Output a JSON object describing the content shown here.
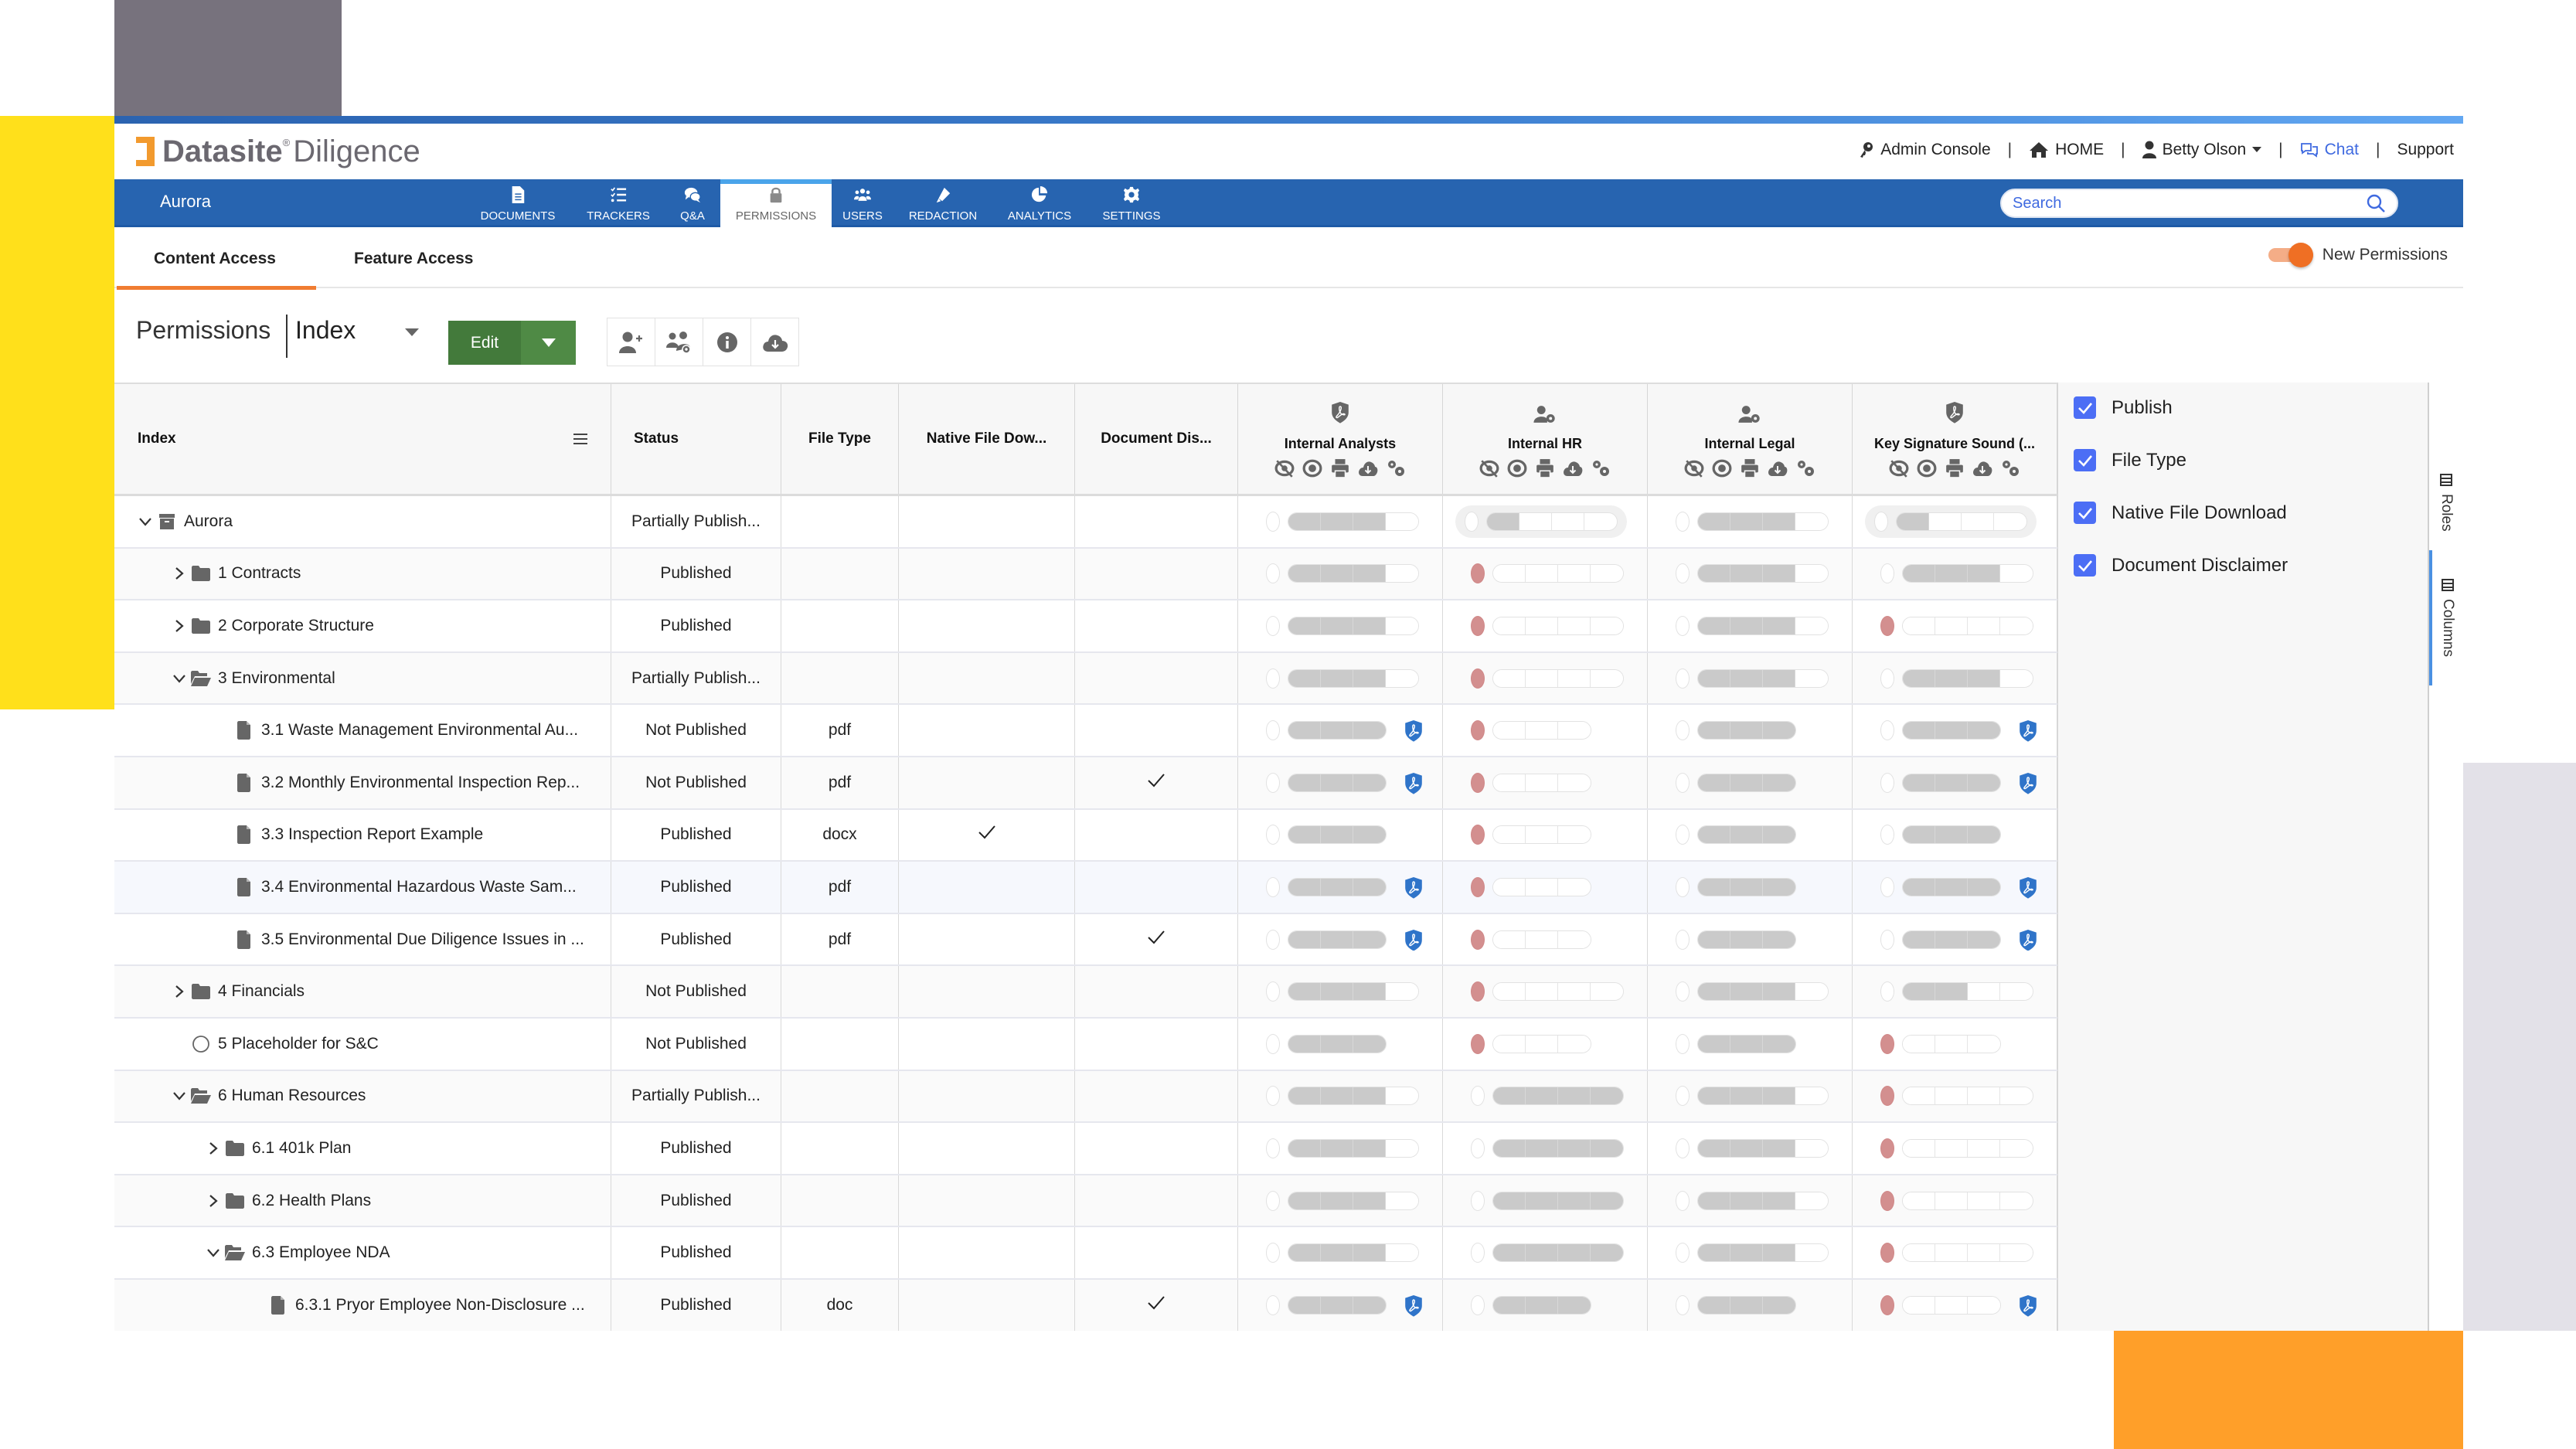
{
  "header": {
    "brand": "Datasite",
    "product": "Diligence",
    "utility_links": [
      {
        "label": "Admin Console",
        "icon": "key-icon"
      },
      {
        "label": "HOME",
        "icon": "home-icon"
      },
      {
        "label": "Betty Olson",
        "icon": "user-icon"
      },
      {
        "label": "Chat",
        "icon": "chat-icon"
      },
      {
        "label": "Support",
        "icon": ""
      }
    ]
  },
  "nav": {
    "project": "Aurora",
    "tabs": [
      {
        "label": "DOCUMENTS",
        "icon": "document-icon",
        "active": false
      },
      {
        "label": "TRACKERS",
        "icon": "tracker-list-icon",
        "active": false
      },
      {
        "label": "Q&A",
        "icon": "chat-bubbles-icon",
        "active": false
      },
      {
        "label": "PERMISSIONS",
        "icon": "lock-icon",
        "active": true
      },
      {
        "label": "USERS",
        "icon": "users-icon",
        "active": false
      },
      {
        "label": "REDACTION",
        "icon": "highlighter-icon",
        "active": false
      },
      {
        "label": "ANALYTICS",
        "icon": "pie-chart-icon",
        "active": false
      },
      {
        "label": "SETTINGS",
        "icon": "gear-icon",
        "active": false
      }
    ],
    "search_placeholder": "Search"
  },
  "subtabs": {
    "items": [
      "Content Access",
      "Feature Access"
    ],
    "active": "Content Access",
    "toggle_label": "New Permissions",
    "toggle_on": true
  },
  "toolbar": {
    "title": "Permissions",
    "view_select": "Index",
    "edit_label": "Edit",
    "icon_buttons": [
      "add-user-icon",
      "manage-groups-icon",
      "info-icon",
      "cloud-download-icon"
    ]
  },
  "grid": {
    "columns": {
      "index": "Index",
      "status": "Status",
      "file_type": "File Type",
      "native": "Native File Dow...",
      "disclaimer": "Document Dis..."
    },
    "roles": [
      {
        "name": "Internal Analysts",
        "icon": "shield-pdf-icon"
      },
      {
        "name": "Internal HR",
        "icon": "user-gear-icon"
      },
      {
        "name": "Internal Legal",
        "icon": "user-gear-icon"
      },
      {
        "name": "Key Signature Sound (...",
        "icon": "shield-pdf-icon"
      }
    ],
    "permission_icons": [
      "hidden-icon",
      "view-icon",
      "print-icon",
      "download-icon",
      "settings-icon"
    ],
    "rows": [
      {
        "name": "Aurora",
        "type": "root",
        "level": 0,
        "expanded": true,
        "status": "Partially Publish...",
        "file_type": "",
        "native": false,
        "disclaimer": false,
        "perms": [
          {
            "red": false,
            "level": 3,
            "segs": 4,
            "pdf": false
          },
          {
            "red": false,
            "level": 1,
            "segs": 4,
            "pdf": false,
            "selected": true
          },
          {
            "red": false,
            "level": 3,
            "segs": 4,
            "pdf": false
          },
          {
            "red": false,
            "level": 1,
            "segs": 4,
            "pdf": false,
            "selected": true
          }
        ]
      },
      {
        "name": "1 Contracts",
        "type": "folder",
        "level": 1,
        "expanded": false,
        "status": "Published",
        "file_type": "",
        "native": false,
        "disclaimer": false,
        "perms": [
          {
            "red": false,
            "level": 3,
            "segs": 4
          },
          {
            "red": true,
            "level": 0,
            "segs": 4
          },
          {
            "red": false,
            "level": 3,
            "segs": 4
          },
          {
            "red": false,
            "level": 3,
            "segs": 4
          }
        ]
      },
      {
        "name": "2 Corporate Structure",
        "type": "folder",
        "level": 1,
        "expanded": false,
        "status": "Published",
        "file_type": "",
        "native": false,
        "disclaimer": false,
        "perms": [
          {
            "red": false,
            "level": 3,
            "segs": 4
          },
          {
            "red": true,
            "level": 0,
            "segs": 4
          },
          {
            "red": false,
            "level": 3,
            "segs": 4
          },
          {
            "red": true,
            "level": 0,
            "segs": 4
          }
        ]
      },
      {
        "name": "3 Environmental",
        "type": "folder-open",
        "level": 1,
        "expanded": true,
        "status": "Partially Publish...",
        "file_type": "",
        "native": false,
        "disclaimer": false,
        "perms": [
          {
            "red": false,
            "level": 3,
            "segs": 4
          },
          {
            "red": true,
            "level": 0,
            "segs": 4
          },
          {
            "red": false,
            "level": 3,
            "segs": 4
          },
          {
            "red": false,
            "level": 3,
            "segs": 4
          }
        ]
      },
      {
        "name": "3.1 Waste Management Environmental Au...",
        "type": "file",
        "level": 2,
        "status": "Not Published",
        "file_type": "pdf",
        "native": false,
        "disclaimer": false,
        "perms": [
          {
            "red": false,
            "level": 3,
            "segs": 3,
            "pdf": true
          },
          {
            "red": true,
            "level": 0,
            "segs": 3
          },
          {
            "red": false,
            "level": 3,
            "segs": 3
          },
          {
            "red": false,
            "level": 3,
            "segs": 3,
            "pdf": true
          }
        ]
      },
      {
        "name": "3.2 Monthly Environmental Inspection Rep...",
        "type": "file",
        "level": 2,
        "status": "Not Published",
        "file_type": "pdf",
        "native": false,
        "disclaimer": true,
        "perms": [
          {
            "red": false,
            "level": 3,
            "segs": 3,
            "pdf": true
          },
          {
            "red": true,
            "level": 0,
            "segs": 3
          },
          {
            "red": false,
            "level": 3,
            "segs": 3
          },
          {
            "red": false,
            "level": 3,
            "segs": 3,
            "pdf": true
          }
        ]
      },
      {
        "name": "3.3 Inspection Report Example",
        "type": "file",
        "level": 2,
        "status": "Published",
        "file_type": "docx",
        "native": true,
        "disclaimer": false,
        "perms": [
          {
            "red": false,
            "level": 3,
            "segs": 3
          },
          {
            "red": true,
            "level": 0,
            "segs": 3
          },
          {
            "red": false,
            "level": 3,
            "segs": 3
          },
          {
            "red": false,
            "level": 3,
            "segs": 3
          }
        ]
      },
      {
        "name": "3.4 Environmental Hazardous Waste Sam...",
        "type": "file",
        "level": 2,
        "status": "Published",
        "file_type": "pdf",
        "native": false,
        "disclaimer": false,
        "hover": true,
        "perms": [
          {
            "red": false,
            "level": 3,
            "segs": 3,
            "pdf": true
          },
          {
            "red": true,
            "level": 0,
            "segs": 3
          },
          {
            "red": false,
            "level": 3,
            "segs": 3
          },
          {
            "red": false,
            "level": 3,
            "segs": 3,
            "pdf": true
          }
        ]
      },
      {
        "name": "3.5 Environmental Due Diligence Issues in ...",
        "type": "file",
        "level": 2,
        "status": "Published",
        "file_type": "pdf",
        "native": false,
        "disclaimer": true,
        "perms": [
          {
            "red": false,
            "level": 3,
            "segs": 3,
            "pdf": true
          },
          {
            "red": true,
            "level": 0,
            "segs": 3
          },
          {
            "red": false,
            "level": 3,
            "segs": 3
          },
          {
            "red": false,
            "level": 3,
            "segs": 3,
            "pdf": true
          }
        ]
      },
      {
        "name": "4 Financials",
        "type": "folder",
        "level": 1,
        "expanded": false,
        "status": "Not Published",
        "file_type": "",
        "native": false,
        "disclaimer": false,
        "perms": [
          {
            "red": false,
            "level": 3,
            "segs": 4
          },
          {
            "red": true,
            "level": 0,
            "segs": 4
          },
          {
            "red": false,
            "level": 3,
            "segs": 4
          },
          {
            "red": false,
            "level": 2,
            "segs": 4
          }
        ]
      },
      {
        "name": "5 Placeholder for S&C",
        "type": "placeholder",
        "level": 1,
        "status": "Not Published",
        "file_type": "",
        "native": false,
        "disclaimer": false,
        "perms": [
          {
            "red": false,
            "level": 3,
            "segs": 3
          },
          {
            "red": true,
            "level": 0,
            "segs": 3
          },
          {
            "red": false,
            "level": 3,
            "segs": 3
          },
          {
            "red": true,
            "level": 0,
            "segs": 3
          }
        ]
      },
      {
        "name": "6 Human Resources",
        "type": "folder-open",
        "level": 1,
        "expanded": true,
        "status": "Partially Publish...",
        "file_type": "",
        "native": false,
        "disclaimer": false,
        "perms": [
          {
            "red": false,
            "level": 3,
            "segs": 4
          },
          {
            "red": false,
            "level": 4,
            "segs": 4
          },
          {
            "red": false,
            "level": 3,
            "segs": 4
          },
          {
            "red": true,
            "level": 0,
            "segs": 4
          }
        ]
      },
      {
        "name": "6.1 401k Plan",
        "type": "folder",
        "level": 2,
        "expanded": false,
        "status": "Published",
        "file_type": "",
        "native": false,
        "disclaimer": false,
        "perms": [
          {
            "red": false,
            "level": 3,
            "segs": 4
          },
          {
            "red": false,
            "level": 4,
            "segs": 4
          },
          {
            "red": false,
            "level": 3,
            "segs": 4
          },
          {
            "red": true,
            "level": 0,
            "segs": 4
          }
        ]
      },
      {
        "name": "6.2 Health Plans",
        "type": "folder",
        "level": 2,
        "expanded": false,
        "status": "Published",
        "file_type": "",
        "native": false,
        "disclaimer": false,
        "perms": [
          {
            "red": false,
            "level": 3,
            "segs": 4
          },
          {
            "red": false,
            "level": 4,
            "segs": 4
          },
          {
            "red": false,
            "level": 3,
            "segs": 4
          },
          {
            "red": true,
            "level": 0,
            "segs": 4
          }
        ]
      },
      {
        "name": "6.3 Employee NDA",
        "type": "folder-open",
        "level": 2,
        "expanded": true,
        "status": "Published",
        "file_type": "",
        "native": false,
        "disclaimer": false,
        "perms": [
          {
            "red": false,
            "level": 3,
            "segs": 4
          },
          {
            "red": false,
            "level": 4,
            "segs": 4
          },
          {
            "red": false,
            "level": 3,
            "segs": 4
          },
          {
            "red": true,
            "level": 0,
            "segs": 4
          }
        ]
      },
      {
        "name": "6.3.1 Pryor Employee Non-Disclosure ...",
        "type": "file",
        "level": 3,
        "status": "Published",
        "file_type": "doc",
        "native": false,
        "disclaimer": true,
        "perms": [
          {
            "red": false,
            "level": 3,
            "segs": 3,
            "pdf": true
          },
          {
            "red": false,
            "level": 3,
            "segs": 3
          },
          {
            "red": false,
            "level": 3,
            "segs": 3
          },
          {
            "red": true,
            "level": 0,
            "segs": 3,
            "pdf": true
          }
        ]
      }
    ]
  },
  "column_panel": {
    "options": [
      {
        "label": "Publish",
        "checked": true
      },
      {
        "label": "File Type",
        "checked": true
      },
      {
        "label": "Native File Download",
        "checked": true
      },
      {
        "label": "Document Disclaimer",
        "checked": true
      }
    ],
    "side_tabs": [
      {
        "label": "Roles",
        "active": false
      },
      {
        "label": "Columns",
        "active": true
      }
    ]
  },
  "colors": {
    "nav_blue": "#2764b0",
    "accent_orange": "#f07c31",
    "edit_green": "#437a3b",
    "checkbox_blue": "#4c6ef5",
    "denied_red": "#d38f8f",
    "pdf_shield_blue": "#2f74c9"
  }
}
